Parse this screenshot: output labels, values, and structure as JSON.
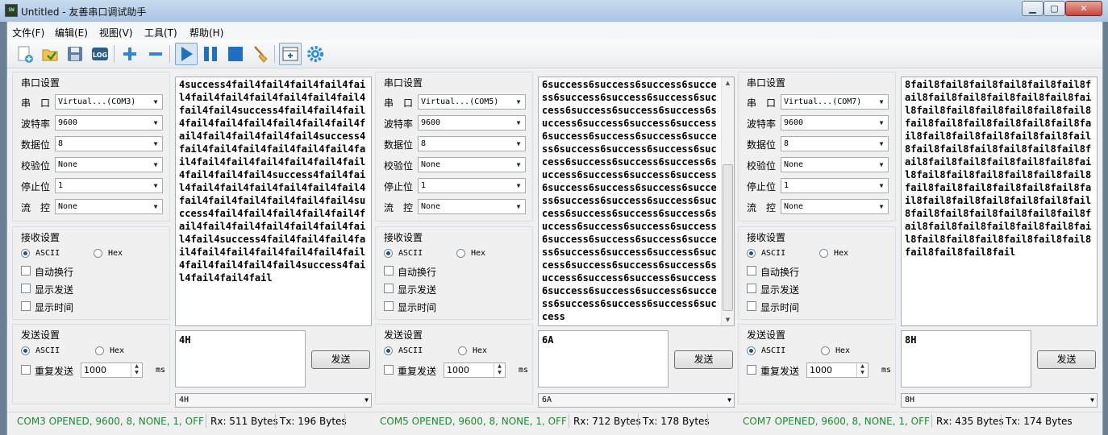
{
  "window": {
    "title": "Untitled - 友善串口调试助手",
    "icon_text": "SW"
  },
  "menu": [
    "文件(F)",
    "编辑(E)",
    "视图(V)",
    "工具(T)",
    "帮助(H)"
  ],
  "toolbar": [
    "new-file-icon",
    "open-icon",
    "save-icon",
    "log-icon",
    "add-icon",
    "remove-icon",
    "play-icon",
    "pause-icon",
    "stop-icon",
    "clear-broom-icon",
    "add-panel-icon",
    "settings-gear-icon"
  ],
  "labels": {
    "serial_settings": "串口设置",
    "port": "串　口",
    "baud": "波特率",
    "databits": "数据位",
    "parity": "校验位",
    "stopbits": "停止位",
    "flow": "流　控",
    "recv_settings": "接收设置",
    "ascii": "ASCII",
    "hex": "Hex",
    "autowrap": "自动换行",
    "show_send": "显示发送",
    "show_time": "显示时间",
    "send_settings": "发送设置",
    "repeat_send": "重复发送",
    "ms": "ms",
    "send_button": "发送"
  },
  "panels": [
    {
      "port": "Virtual...(COM3)",
      "baud": "9600",
      "databits": "8",
      "parity": "None",
      "stopbits": "1",
      "flow": "None",
      "repeat_ms": "1000",
      "recv_text": "4success4fail4fail4fail4fail4fail4fail4fail4fail4fail4fail4fail4fail4fail4success4fail4fail4fail4fail4fail4fail4fail4fail4fail4fail4fail4fail4fail4fail4success4fail4fail4fail4fail4fail4fail4fail4fail4fail4fail4fail4fail4fail4fail4fail4fail4success4fail4fail4fail4fail4fail4fail4fail4fail4fail4fail4fail4fail4fail4fail4success4fail4fail4fail4fail4fail4fail4fail4fail4fail4fail4fail4fail4fail4success4fail4fail4fail4fail4fail4fail4fail4fail4fail4fail4fail4fail4fail4fail4success4fail4fail4fail4fail",
      "send_text": "4H",
      "history": "4H",
      "status": {
        "port": "COM3 OPENED, 9600, 8, NONE, 1, OFF",
        "rx": "Rx: 511 Bytes",
        "tx": "Tx: 196 Bytes"
      }
    },
    {
      "port": "Virtual...(COM5)",
      "baud": "9600",
      "databits": "8",
      "parity": "None",
      "stopbits": "1",
      "flow": "None",
      "repeat_ms": "1000",
      "recv_text": "6success6success6success6success6success6success6success6success6success6success6success6success6success6success6success6success6success6success6success6success6success6success6success6success6success6success6success6success6success6success6success6success6success6success6success6success6success6success6success6success6success6success6success6success6success6success6success6success6success6success6success6success6success6success6success6success6success6success6success6success6success6success6success6success6success6success6success6success",
      "send_text": "6A",
      "history": "6A",
      "status": {
        "port": "COM5 OPENED, 9600, 8, NONE, 1, OFF",
        "rx": "Rx: 712 Bytes",
        "tx": "Tx: 178 Bytes"
      }
    },
    {
      "port": "Virtual...(COM7)",
      "baud": "9600",
      "databits": "8",
      "parity": "None",
      "stopbits": "1",
      "flow": "None",
      "repeat_ms": "1000",
      "recv_text": "8fail8fail8fail8fail8fail8fail8fail8fail8fail8fail8fail8fail8fail8fail8fail8fail8fail8fail8fail8fail8fail8fail8fail8fail8fail8fail8fail8fail8fail8fail8fail8fail8fail8fail8fail8fail8fail8fail8fail8fail8fail8fail8fail8fail8fail8fail8fail8fail8fail8fail8fail8fail8fail8fail8fail8fail8fail8fail8fail8fail8fail8fail8fail8fail8fail8fail8fail8fail8fail8fail8fail8fail8fail8fail8fail8fail8fail8fail8fail8fail8fail8fail8fail8fail8fail8fail8fail",
      "send_text": "8H",
      "history": "8H",
      "status": {
        "port": "COM7 OPENED, 9600, 8, NONE, 1, OFF",
        "rx": "Rx: 435 Bytes",
        "tx": "Tx: 174 Bytes"
      }
    }
  ]
}
